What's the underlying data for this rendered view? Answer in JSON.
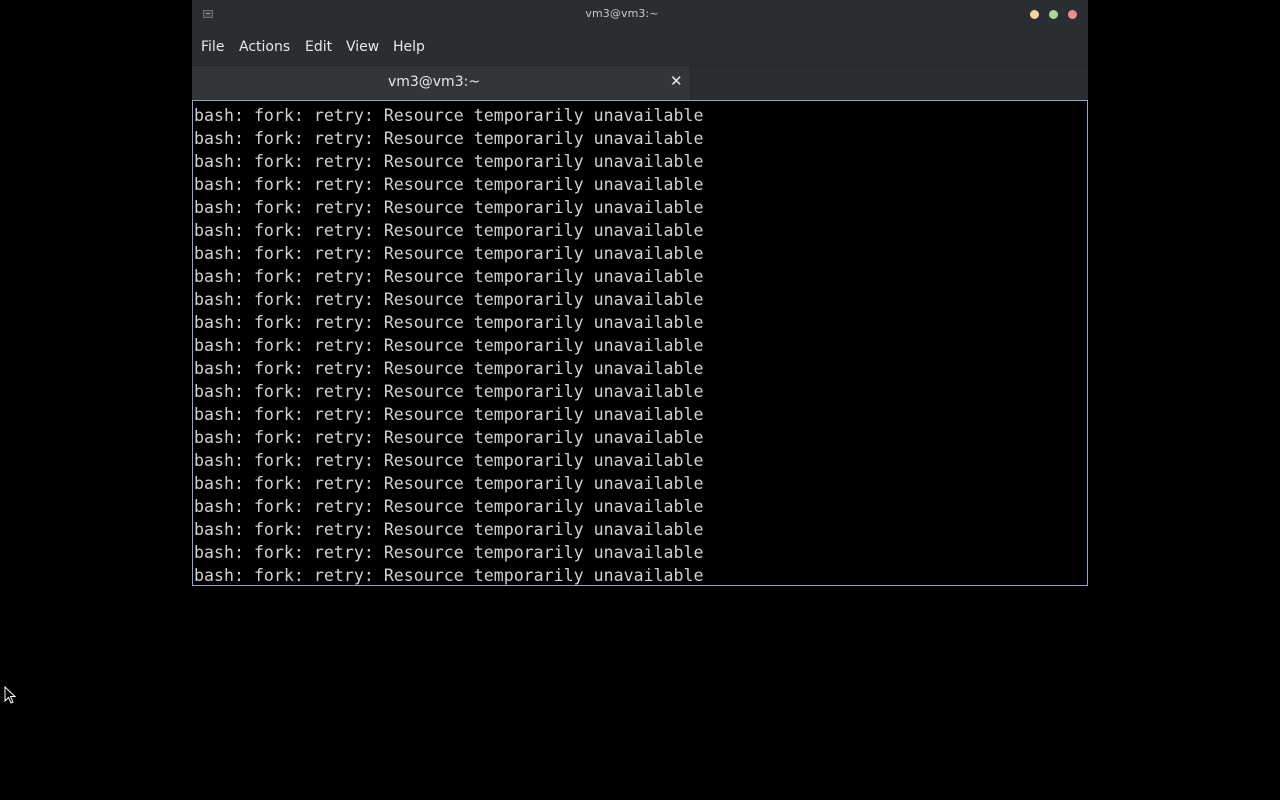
{
  "window": {
    "title": "vm3@vm3:~"
  },
  "menubar": {
    "items": [
      "File",
      "Actions",
      "Edit",
      "View",
      "Help"
    ]
  },
  "tabs": [
    {
      "label": "vm3@vm3:~",
      "close_glyph": "✕"
    }
  ],
  "terminal": {
    "lines": [
      "bash: fork: retry: Resource temporarily unavailable",
      "bash: fork: retry: Resource temporarily unavailable",
      "bash: fork: retry: Resource temporarily unavailable",
      "bash: fork: retry: Resource temporarily unavailable",
      "bash: fork: retry: Resource temporarily unavailable",
      "bash: fork: retry: Resource temporarily unavailable",
      "bash: fork: retry: Resource temporarily unavailable",
      "bash: fork: retry: Resource temporarily unavailable",
      "bash: fork: retry: Resource temporarily unavailable",
      "bash: fork: retry: Resource temporarily unavailable",
      "bash: fork: retry: Resource temporarily unavailable",
      "bash: fork: retry: Resource temporarily unavailable",
      "bash: fork: retry: Resource temporarily unavailable",
      "bash: fork: retry: Resource temporarily unavailable",
      "bash: fork: retry: Resource temporarily unavailable",
      "bash: fork: retry: Resource temporarily unavailable",
      "bash: fork: retry: Resource temporarily unavailable",
      "bash: fork: retry: Resource temporarily unavailable",
      "bash: fork: retry: Resource temporarily unavailable",
      "bash: fork: retry: Resource temporarily unavailable",
      "bash: fork: retry: Resource temporarily unavailable"
    ]
  },
  "colors": {
    "background": "#000000",
    "window_chrome": "#2a2e32",
    "terminal_text": "#d0d0d0",
    "focus_border": "#8fa5cc",
    "minimize": "#f5d49b",
    "maximize": "#a9d79b",
    "close": "#ee8f8f"
  },
  "icons": {
    "app": "terminal-icon",
    "minimize": "minimize-icon",
    "maximize": "maximize-icon",
    "close": "close-icon",
    "pointer": "mouse-pointer-icon"
  }
}
